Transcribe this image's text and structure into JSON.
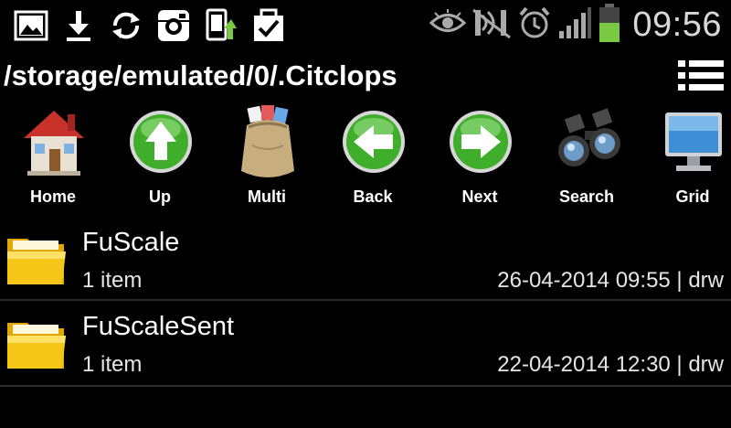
{
  "status_bar": {
    "left_icons": [
      "gallery-icon",
      "download-icon",
      "sync-icon",
      "instagram-icon",
      "device-update-icon",
      "clipboard-check-icon"
    ],
    "right_icons": [
      "eye-icon",
      "mute-icon",
      "alarm-icon",
      "signal-icon",
      "battery-icon"
    ],
    "time": "09:56",
    "battery_color": "#7ac943"
  },
  "path_bar": {
    "path": "/storage/emulated/0/.Citclops",
    "menu_icon": "list-menu-icon"
  },
  "toolbar": {
    "items": [
      {
        "label": "Home",
        "icon": "home-icon"
      },
      {
        "label": "Up",
        "icon": "arrow-up-icon"
      },
      {
        "label": "Multi",
        "icon": "multi-sack-icon"
      },
      {
        "label": "Back",
        "icon": "arrow-left-icon"
      },
      {
        "label": "Next",
        "icon": "arrow-right-icon"
      },
      {
        "label": "Search",
        "icon": "binoculars-icon"
      },
      {
        "label": "Grid",
        "icon": "monitor-icon"
      }
    ]
  },
  "files": [
    {
      "name": "FuScale",
      "count": "1 item",
      "meta": "26-04-2014 09:55 | drw",
      "icon": "folder-icon"
    },
    {
      "name": "FuScaleSent",
      "count": "1 item",
      "meta": "22-04-2014 12:30 | drw",
      "icon": "folder-icon"
    }
  ],
  "colors": {
    "background": "#000000",
    "green_button": "#3fae2a",
    "folder_yellow": "#f5c518"
  }
}
